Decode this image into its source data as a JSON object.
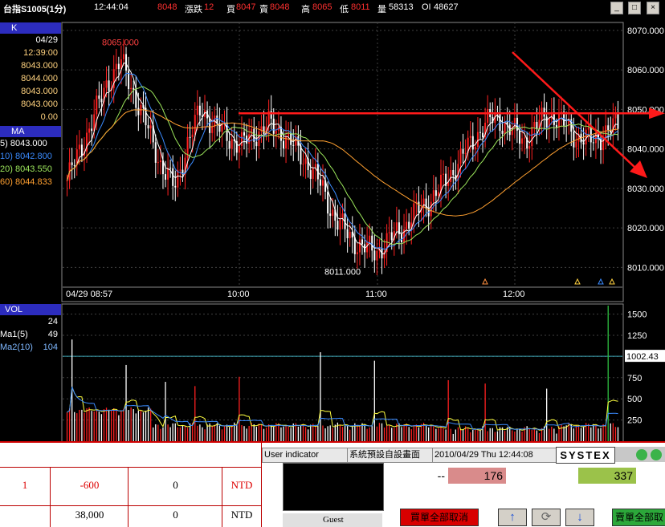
{
  "header": {
    "symbol": "台指S1005(1分)",
    "time": "12:44:04",
    "price": "8048",
    "change_label": "漲跌",
    "change_value": "12",
    "buy_label": "買",
    "buy_value": "8047",
    "sell_label": "賣",
    "sell_value": "8048",
    "high_label": "高",
    "high_value": "8065",
    "low_label": "低",
    "low_value": "8011",
    "volume_label": "量",
    "volume_value": "58313",
    "oi_label": "OI",
    "oi_value": "48627"
  },
  "k_panel": {
    "title": "K",
    "rows": [
      "04/29",
      "12:39:00",
      "8043.000",
      "8044.000",
      "8043.000",
      "8043.000",
      "0.00"
    ]
  },
  "ma_panel": {
    "title": "MA",
    "rows": [
      "5) 8043.000",
      "10) 8042.800",
      "20) 8043.550",
      "60) 8044.833"
    ]
  },
  "vol_panel": {
    "title": "VOL",
    "rows": [
      {
        "label": "",
        "value": "24"
      },
      {
        "label": "Ma1(5)",
        "value": "49"
      },
      {
        "label": "Ma2(10)",
        "value": "104"
      }
    ]
  },
  "chart_data": [
    {
      "type": "candlestick",
      "price_axis_ticks": [
        "8070.000",
        "8060.000",
        "8050.000",
        "8040.000",
        "8030.000",
        "8020.000",
        "8010.000"
      ],
      "ylim": [
        8005,
        8072
      ],
      "time_ticks": [
        "04/29 08:57",
        "10:00",
        "11:00",
        "12:00"
      ],
      "annotations": {
        "high": "8065.000",
        "low": "8011.000"
      },
      "high_value": 8065,
      "low_value": 8011,
      "resistance_level": 8049,
      "price_path": [
        8032,
        8040,
        8048,
        8057,
        8062,
        8054,
        8045,
        8036,
        8030,
        8042,
        8050,
        8046,
        8043,
        8041,
        8044,
        8046,
        8044,
        8040,
        8036,
        8030,
        8022,
        8018,
        8015,
        8014,
        8017,
        8020,
        8024,
        8027,
        8031,
        8036,
        8041,
        8046,
        8048,
        8045,
        8042,
        8046,
        8049,
        8046,
        8043,
        8042,
        8044,
        8046
      ]
    },
    {
      "type": "bar",
      "title": "VOL",
      "axis_ticks": [
        "1500",
        "1250",
        "1000",
        "750",
        "500",
        "250"
      ],
      "ylim": [
        0,
        1600
      ],
      "reference_value": "1002.43",
      "peak_values": [
        1200,
        900,
        700,
        650,
        760,
        1050,
        950,
        720,
        680,
        620,
        1600
      ]
    }
  ],
  "bottom": {
    "row1": [
      "1",
      "-600",
      "0",
      "NTD"
    ],
    "row2": [
      "",
      "38,000",
      "0",
      "NTD"
    ],
    "user_indicator": "User indicator",
    "default_screen": "系統預設自設畫面",
    "datetime": "2010/04/29 Thu 12:44:08",
    "brand": "SYSTEX",
    "guest": "Guest",
    "dash": "--",
    "bid_qty": "176",
    "ask_qty": "337",
    "cancel_all_buy": "買單全部取消",
    "cancel_all_sell": "賣單全部取",
    "up_arrow": "↑",
    "refresh": "⟳",
    "down_arrow": "↓"
  }
}
